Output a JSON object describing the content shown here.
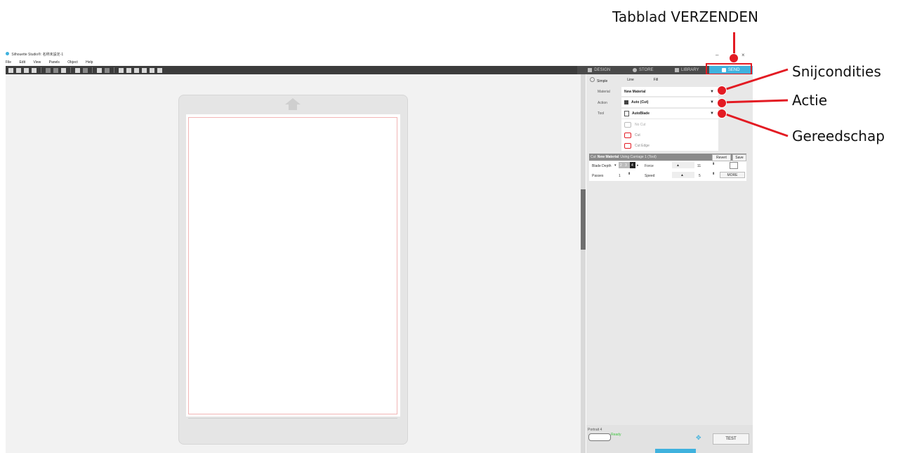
{
  "callouts": {
    "send_tab": "Tabblad VERZENDEN",
    "cut_conditions": "Snijcondities",
    "action": "Actie",
    "tool": "Gereedschap"
  },
  "window": {
    "title": "Silhouette Studio®: 名称未設定-1",
    "minimize": "–",
    "close": "×"
  },
  "menu": [
    "File",
    "Edit",
    "View",
    "Panels",
    "Object",
    "Help"
  ],
  "tabs": [
    {
      "label": "DESIGN",
      "icon": "grid-icon"
    },
    {
      "label": "STORE",
      "icon": "store-icon"
    },
    {
      "label": "LIBRARY",
      "icon": "library-icon"
    },
    {
      "label": "SEND",
      "icon": "send-icon",
      "active": true
    }
  ],
  "modes": [
    "Simple",
    "Line",
    "Fill"
  ],
  "send_panel": {
    "material_label": "Material",
    "material_value": "New Material",
    "action_label": "Action",
    "action_value": "Auto (Cut)",
    "tool_label": "Tool",
    "tool_value": "AutoBlade",
    "tool_options": [
      "No Cut",
      "Cut",
      "Cut Edge"
    ],
    "cut_bar_prefix": "Cut",
    "cut_bar_material": "New Material",
    "cut_bar_suffix": "Using Carriage 1 (Tool)",
    "revert": "Revert",
    "save": "Save",
    "blade_depth_label": "Blade Depth",
    "blade_depth_values": [
      "2",
      "3",
      "4"
    ],
    "force_label": "Force",
    "force_value": "11",
    "passes_label": "Passes",
    "passes_value": "1",
    "speed_label": "Speed",
    "speed_value": "5",
    "more": "MORE"
  },
  "device": {
    "name": "Portrait 4",
    "status": "Ready",
    "test": "TEST"
  },
  "colors": {
    "accent": "#3fb2de",
    "annotation": "#e31b23",
    "ready": "#3dc43d"
  }
}
